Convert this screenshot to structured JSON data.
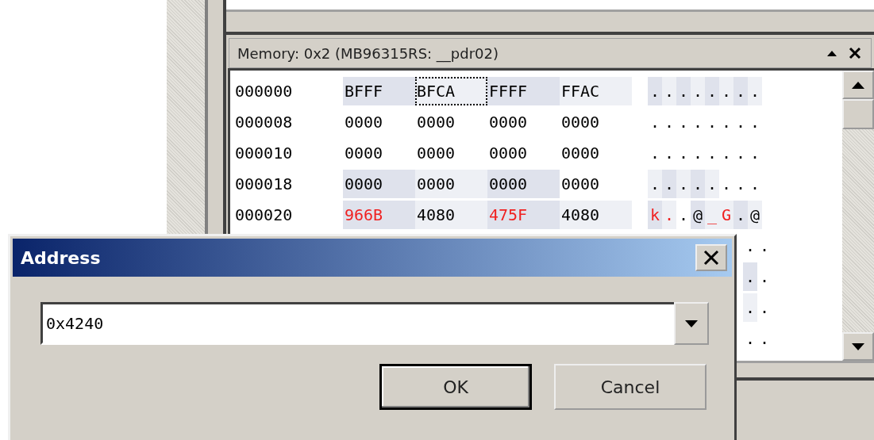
{
  "memory_window": {
    "title": "Memory: 0x2 (MB96315RS: __pdr02)",
    "rows": [
      {
        "kind": "full",
        "address": "000000",
        "cells": [
          {
            "text": "BFFF",
            "color": "#dfe2ec",
            "changed": false,
            "focused": false
          },
          {
            "text": "BFCA",
            "color": "#eef0f5",
            "changed": false,
            "focused": true
          },
          {
            "text": "FFFF",
            "color": "#dfe2ec",
            "changed": false,
            "focused": false
          },
          {
            "text": "FFAC",
            "color": "#eef0f5",
            "changed": false,
            "focused": false
          }
        ],
        "ascii": [
          {
            "ch": ".",
            "color": "#dfe2ec",
            "changed": false
          },
          {
            "ch": ".",
            "color": "#eef0f5",
            "changed": false
          },
          {
            "ch": ".",
            "color": "#dfe2ec",
            "changed": false
          },
          {
            "ch": ".",
            "color": "#eef0f5",
            "changed": false
          },
          {
            "ch": ".",
            "color": "#dfe2ec",
            "changed": false
          },
          {
            "ch": ".",
            "color": "#eef0f5",
            "changed": false
          },
          {
            "ch": ".",
            "color": "#dfe2ec",
            "changed": false
          },
          {
            "ch": ".",
            "color": "#eef0f5",
            "changed": false
          }
        ]
      },
      {
        "kind": "full",
        "address": "000008",
        "cells": [
          {
            "text": "0000",
            "color": "#ffffff",
            "changed": false,
            "focused": false
          },
          {
            "text": "0000",
            "color": "#ffffff",
            "changed": false,
            "focused": false
          },
          {
            "text": "0000",
            "color": "#ffffff",
            "changed": false,
            "focused": false
          },
          {
            "text": "0000",
            "color": "#ffffff",
            "changed": false,
            "focused": false
          }
        ],
        "ascii": [
          {
            "ch": ".",
            "color": "#ffffff",
            "changed": false
          },
          {
            "ch": ".",
            "color": "#ffffff",
            "changed": false
          },
          {
            "ch": ".",
            "color": "#ffffff",
            "changed": false
          },
          {
            "ch": ".",
            "color": "#ffffff",
            "changed": false
          },
          {
            "ch": ".",
            "color": "#ffffff",
            "changed": false
          },
          {
            "ch": ".",
            "color": "#ffffff",
            "changed": false
          },
          {
            "ch": ".",
            "color": "#ffffff",
            "changed": false
          },
          {
            "ch": ".",
            "color": "#ffffff",
            "changed": false
          }
        ]
      },
      {
        "kind": "full",
        "address": "000010",
        "cells": [
          {
            "text": "0000",
            "color": "#ffffff",
            "changed": false,
            "focused": false
          },
          {
            "text": "0000",
            "color": "#ffffff",
            "changed": false,
            "focused": false
          },
          {
            "text": "0000",
            "color": "#ffffff",
            "changed": false,
            "focused": false
          },
          {
            "text": "0000",
            "color": "#ffffff",
            "changed": false,
            "focused": false
          }
        ],
        "ascii": [
          {
            "ch": ".",
            "color": "#ffffff",
            "changed": false
          },
          {
            "ch": ".",
            "color": "#ffffff",
            "changed": false
          },
          {
            "ch": ".",
            "color": "#ffffff",
            "changed": false
          },
          {
            "ch": ".",
            "color": "#ffffff",
            "changed": false
          },
          {
            "ch": ".",
            "color": "#ffffff",
            "changed": false
          },
          {
            "ch": ".",
            "color": "#ffffff",
            "changed": false
          },
          {
            "ch": ".",
            "color": "#ffffff",
            "changed": false
          },
          {
            "ch": ".",
            "color": "#ffffff",
            "changed": false
          }
        ]
      },
      {
        "kind": "full",
        "address": "000018",
        "cells": [
          {
            "text": "0000",
            "color": "#dfe2ec",
            "changed": false,
            "focused": false
          },
          {
            "text": "0000",
            "color": "#eef0f5",
            "changed": false,
            "focused": false
          },
          {
            "text": "0000",
            "color": "#dfe2ec",
            "changed": false,
            "focused": false
          },
          {
            "text": "0000",
            "color": "#ffffff",
            "changed": false,
            "focused": false
          }
        ],
        "ascii": [
          {
            "ch": ".",
            "color": "#eef0f5",
            "changed": false
          },
          {
            "ch": ".",
            "color": "#dfe2ec",
            "changed": false
          },
          {
            "ch": ".",
            "color": "#eef0f5",
            "changed": false
          },
          {
            "ch": ".",
            "color": "#dfe2ec",
            "changed": false
          },
          {
            "ch": ".",
            "color": "#eef0f5",
            "changed": false
          },
          {
            "ch": ".",
            "color": "#ffffff",
            "changed": false
          },
          {
            "ch": ".",
            "color": "#ffffff",
            "changed": false
          },
          {
            "ch": ".",
            "color": "#ffffff",
            "changed": false
          }
        ]
      },
      {
        "kind": "full",
        "address": "000020",
        "cells": [
          {
            "text": "966B",
            "color": "#dfe2ec",
            "changed": true,
            "focused": false
          },
          {
            "text": "4080",
            "color": "#eef0f5",
            "changed": false,
            "focused": false
          },
          {
            "text": "475F",
            "color": "#dfe2ec",
            "changed": true,
            "focused": false
          },
          {
            "text": "4080",
            "color": "#eef0f5",
            "changed": false,
            "focused": false
          }
        ],
        "ascii": [
          {
            "ch": "k",
            "color": "#dfe2ec",
            "changed": true
          },
          {
            "ch": ".",
            "color": "#eef0f5",
            "changed": true
          },
          {
            "ch": ".",
            "color": "#ffffff",
            "changed": false
          },
          {
            "ch": "@",
            "color": "#dfe2ec",
            "changed": false
          },
          {
            "ch": "_",
            "color": "#eef0f5",
            "changed": true
          },
          {
            "ch": "G",
            "color": "#eef0f5",
            "changed": true
          },
          {
            "ch": ".",
            "color": "#dfe2ec",
            "changed": false
          },
          {
            "ch": "@",
            "color": "#eef0f5",
            "changed": false
          }
        ]
      },
      {
        "kind": "partial",
        "ascii": [
          {
            "ch": ".",
            "color": "#ffffff",
            "changed": false
          },
          {
            "ch": ".",
            "color": "#ffffff",
            "changed": false
          }
        ]
      },
      {
        "kind": "partial",
        "ascii": [
          {
            "ch": ".",
            "color": "#dfe2ec",
            "changed": false
          },
          {
            "ch": ".",
            "color": "#ffffff",
            "changed": false
          }
        ]
      },
      {
        "kind": "partial",
        "ascii": [
          {
            "ch": ".",
            "color": "#eef0f5",
            "changed": false
          },
          {
            "ch": ".",
            "color": "#ffffff",
            "changed": false
          }
        ]
      },
      {
        "kind": "partial",
        "ascii": [
          {
            "ch": ".",
            "color": "#ffffff",
            "changed": false
          },
          {
            "ch": ".",
            "color": "#ffffff",
            "changed": false
          }
        ]
      }
    ]
  },
  "dialog": {
    "title": "Address",
    "value": "0x4240",
    "buttons": [
      {
        "label": "OK",
        "default": true
      },
      {
        "label": "Cancel",
        "default": false
      }
    ]
  }
}
